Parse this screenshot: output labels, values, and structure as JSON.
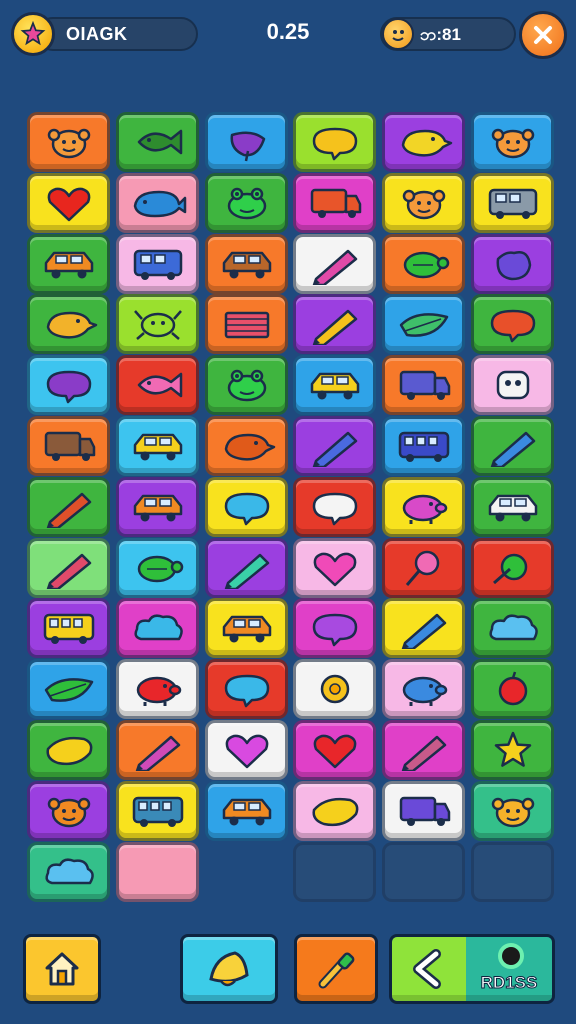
{
  "hud": {
    "player_name": "OIAGK",
    "score": "0.25",
    "timer": "ဘ:81",
    "star_icon": "star-icon",
    "timer_icon": "clock-face-icon",
    "close_icon": "close-icon"
  },
  "colors": {
    "background": "#1f4a7e",
    "orange": "#f7792a",
    "green": "#3fb53f",
    "blue": "#2fa3e8",
    "lime": "#9ae02e",
    "purple": "#9b3fe0",
    "yellow": "#f8e21e",
    "pink": "#f69ab4",
    "red": "#e63a2a",
    "magenta": "#e040c8",
    "white": "#f4f4f4",
    "light_pink": "#f7b8e6",
    "light_green": "#7fe07a",
    "sky": "#3dc4ef",
    "teal": "#34c08a",
    "empty": "#274c78"
  },
  "board": {
    "columns": 6,
    "tiles": [
      {
        "row": 0,
        "col": 0,
        "color": "orange",
        "icon": "monkey-icon",
        "glyph": "#f59a3a"
      },
      {
        "row": 0,
        "col": 1,
        "color": "green",
        "icon": "fish-icon",
        "glyph": "#2e8c2e"
      },
      {
        "row": 0,
        "col": 2,
        "color": "blue",
        "icon": "eggplant-icon",
        "glyph": "#8a3cc8"
      },
      {
        "row": 0,
        "col": 3,
        "color": "lime",
        "icon": "speech-bubble-icon",
        "glyph": "#f5c21c"
      },
      {
        "row": 0,
        "col": 4,
        "color": "purple",
        "icon": "bird-icon",
        "glyph": "#f2d526"
      },
      {
        "row": 0,
        "col": 5,
        "color": "blue",
        "icon": "monkey-icon",
        "glyph": "#f59a3a"
      },
      {
        "row": 1,
        "col": 0,
        "color": "yellow",
        "icon": "heart-icon",
        "glyph": "#e8261e"
      },
      {
        "row": 1,
        "col": 1,
        "color": "pink",
        "icon": "whale-icon",
        "glyph": "#2a8ad8"
      },
      {
        "row": 1,
        "col": 2,
        "color": "green",
        "icon": "frog-icon",
        "glyph": "#2fcf4a"
      },
      {
        "row": 1,
        "col": 3,
        "color": "magenta",
        "icon": "truck-icon",
        "glyph": "#e8552a"
      },
      {
        "row": 1,
        "col": 4,
        "color": "yellow",
        "icon": "monkey-icon",
        "glyph": "#f59a3a"
      },
      {
        "row": 1,
        "col": 5,
        "color": "yellow",
        "icon": "van-icon",
        "glyph": "#8a9aa8"
      },
      {
        "row": 2,
        "col": 0,
        "color": "green",
        "icon": "car-icon",
        "glyph": "#f08a22"
      },
      {
        "row": 2,
        "col": 1,
        "color": "light_pink",
        "icon": "van-icon",
        "glyph": "#3c6ad8"
      },
      {
        "row": 2,
        "col": 2,
        "color": "orange",
        "icon": "car-icon",
        "glyph": "#b8662a"
      },
      {
        "row": 2,
        "col": 3,
        "color": "white",
        "icon": "pencil-icon",
        "glyph": "#e04aa8"
      },
      {
        "row": 2,
        "col": 4,
        "color": "orange",
        "icon": "turtle-icon",
        "glyph": "#2fbf3a"
      },
      {
        "row": 2,
        "col": 5,
        "color": "purple",
        "icon": "bag-icon",
        "glyph": "#6a4ad8"
      },
      {
        "row": 3,
        "col": 0,
        "color": "green",
        "icon": "bird-icon",
        "glyph": "#f2b22a"
      },
      {
        "row": 3,
        "col": 1,
        "color": "lime",
        "icon": "crab-icon",
        "glyph": "#9ae02e"
      },
      {
        "row": 3,
        "col": 2,
        "color": "orange",
        "icon": "book-icon",
        "glyph": "#e8506a"
      },
      {
        "row": 3,
        "col": 3,
        "color": "purple",
        "icon": "pencil-icon",
        "glyph": "#f5c21c"
      },
      {
        "row": 3,
        "col": 4,
        "color": "blue",
        "icon": "leaf-icon",
        "glyph": "#3fbf6a"
      },
      {
        "row": 3,
        "col": 5,
        "color": "green",
        "icon": "speech-bubble-icon",
        "glyph": "#e8502a"
      },
      {
        "row": 4,
        "col": 0,
        "color": "sky",
        "icon": "speech-bubble-icon",
        "glyph": "#8a3cc8"
      },
      {
        "row": 4,
        "col": 1,
        "color": "red",
        "icon": "fish-icon",
        "glyph": "#f06ab4"
      },
      {
        "row": 4,
        "col": 2,
        "color": "green",
        "icon": "frog-icon",
        "glyph": "#2fcf4a"
      },
      {
        "row": 4,
        "col": 3,
        "color": "blue",
        "icon": "car-icon",
        "glyph": "#f5d01c"
      },
      {
        "row": 4,
        "col": 4,
        "color": "orange",
        "icon": "truck-icon",
        "glyph": "#5a5ad0"
      },
      {
        "row": 4,
        "col": 5,
        "color": "light_pink",
        "icon": "robot-icon",
        "glyph": "#f4f4f4"
      },
      {
        "row": 5,
        "col": 0,
        "color": "orange",
        "icon": "truck-icon",
        "glyph": "#8a5a3a"
      },
      {
        "row": 5,
        "col": 1,
        "color": "sky",
        "icon": "car-icon",
        "glyph": "#f5d01c"
      },
      {
        "row": 5,
        "col": 2,
        "color": "orange",
        "icon": "bird-icon",
        "glyph": "#e05a1a"
      },
      {
        "row": 5,
        "col": 3,
        "color": "purple",
        "icon": "pencil-icon",
        "glyph": "#4a6ae0"
      },
      {
        "row": 5,
        "col": 4,
        "color": "blue",
        "icon": "bus-icon",
        "glyph": "#3a4ac8"
      },
      {
        "row": 5,
        "col": 5,
        "color": "green",
        "icon": "pencil-icon",
        "glyph": "#3a8ae0"
      },
      {
        "row": 6,
        "col": 0,
        "color": "green",
        "icon": "pencil-icon",
        "glyph": "#e0502a"
      },
      {
        "row": 6,
        "col": 1,
        "color": "purple",
        "icon": "car-icon",
        "glyph": "#f08a22"
      },
      {
        "row": 6,
        "col": 2,
        "color": "yellow",
        "icon": "speech-bubble-icon",
        "glyph": "#3ab8e8"
      },
      {
        "row": 6,
        "col": 3,
        "color": "red",
        "icon": "speech-bubble-icon",
        "glyph": "#f4f4f4"
      },
      {
        "row": 6,
        "col": 4,
        "color": "yellow",
        "icon": "pig-icon",
        "glyph": "#d84ac8"
      },
      {
        "row": 6,
        "col": 5,
        "color": "green",
        "icon": "car-icon",
        "glyph": "#f4f4f4"
      },
      {
        "row": 7,
        "col": 0,
        "color": "light_green",
        "icon": "pencil-icon",
        "glyph": "#e04a6a"
      },
      {
        "row": 7,
        "col": 1,
        "color": "sky",
        "icon": "turtle-icon",
        "glyph": "#2fbf3a"
      },
      {
        "row": 7,
        "col": 2,
        "color": "purple",
        "icon": "pencil-icon",
        "glyph": "#3ad0a8"
      },
      {
        "row": 7,
        "col": 3,
        "color": "light_pink",
        "icon": "heart-icon",
        "glyph": "#f04ab8"
      },
      {
        "row": 7,
        "col": 4,
        "color": "red",
        "icon": "lollipop-icon",
        "glyph": "#f06ab4"
      },
      {
        "row": 7,
        "col": 5,
        "color": "red",
        "icon": "planet-icon",
        "glyph": "#2fbf3a"
      },
      {
        "row": 8,
        "col": 0,
        "color": "purple",
        "icon": "bus-icon",
        "glyph": "#f5d01c"
      },
      {
        "row": 8,
        "col": 1,
        "color": "magenta",
        "icon": "cloud-icon",
        "glyph": "#3ab8e8"
      },
      {
        "row": 8,
        "col": 2,
        "color": "yellow",
        "icon": "car-icon",
        "glyph": "#f08a22"
      },
      {
        "row": 8,
        "col": 3,
        "color": "magenta",
        "icon": "speech-bubble-icon",
        "glyph": "#a84ae0"
      },
      {
        "row": 8,
        "col": 4,
        "color": "yellow",
        "icon": "pencil-icon",
        "glyph": "#3a8ae0"
      },
      {
        "row": 8,
        "col": 5,
        "color": "green",
        "icon": "cloud-icon",
        "glyph": "#5ac0f0"
      },
      {
        "row": 9,
        "col": 0,
        "color": "blue",
        "icon": "leaf-icon",
        "glyph": "#2fbf3a"
      },
      {
        "row": 9,
        "col": 1,
        "color": "white",
        "icon": "pig-icon",
        "glyph": "#e8262a"
      },
      {
        "row": 9,
        "col": 2,
        "color": "red",
        "icon": "speech-bubble-icon",
        "glyph": "#3ab8e8"
      },
      {
        "row": 9,
        "col": 3,
        "color": "white",
        "icon": "flower-icon",
        "glyph": "#f5c21c"
      },
      {
        "row": 9,
        "col": 4,
        "color": "light_pink",
        "icon": "pig-icon",
        "glyph": "#3a8ae0"
      },
      {
        "row": 9,
        "col": 5,
        "color": "green",
        "icon": "apple-icon",
        "glyph": "#e8262a"
      },
      {
        "row": 10,
        "col": 0,
        "color": "green",
        "icon": "lemon-icon",
        "glyph": "#f5d01c"
      },
      {
        "row": 10,
        "col": 1,
        "color": "orange",
        "icon": "pencil-icon",
        "glyph": "#d04ab8"
      },
      {
        "row": 10,
        "col": 2,
        "color": "white",
        "icon": "heart-icon",
        "glyph": "#d84ae0"
      },
      {
        "row": 10,
        "col": 3,
        "color": "magenta",
        "icon": "heart-icon",
        "glyph": "#e8262a"
      },
      {
        "row": 10,
        "col": 4,
        "color": "magenta",
        "icon": "pencil-icon",
        "glyph": "#c85a8a"
      },
      {
        "row": 10,
        "col": 5,
        "color": "green",
        "icon": "star-icon",
        "glyph": "#f5d01c"
      },
      {
        "row": 11,
        "col": 0,
        "color": "purple",
        "icon": "monkey-icon",
        "glyph": "#f08a22"
      },
      {
        "row": 11,
        "col": 1,
        "color": "yellow",
        "icon": "bus-icon",
        "glyph": "#3a8ab8"
      },
      {
        "row": 11,
        "col": 2,
        "color": "blue",
        "icon": "car-icon",
        "glyph": "#f08a22"
      },
      {
        "row": 11,
        "col": 3,
        "color": "light_pink",
        "icon": "lemon-icon",
        "glyph": "#f5d01c"
      },
      {
        "row": 11,
        "col": 4,
        "color": "white",
        "icon": "truck-icon",
        "glyph": "#6a4ad8"
      },
      {
        "row": 11,
        "col": 5,
        "color": "teal",
        "icon": "monkey-icon",
        "glyph": "#f5b22a"
      },
      {
        "row": 12,
        "col": 0,
        "color": "teal",
        "icon": "cloud-icon",
        "glyph": "#5ac0f0"
      },
      {
        "row": 12,
        "col": 1,
        "color": "pink",
        "icon": "blank",
        "glyph": ""
      },
      {
        "row": 12,
        "col": 3,
        "color": "empty",
        "icon": "blank",
        "glyph": ""
      },
      {
        "row": 12,
        "col": 4,
        "color": "empty",
        "icon": "blank",
        "glyph": ""
      },
      {
        "row": 12,
        "col": 5,
        "color": "empty",
        "icon": "blank",
        "glyph": ""
      }
    ]
  },
  "controls": {
    "home_icon": "home-icon",
    "hint_icon": "bell-icon",
    "shuffle_icon": "dropper-icon",
    "undo_icon": "back-arrow-icon",
    "combo_label": "RD1SS"
  }
}
